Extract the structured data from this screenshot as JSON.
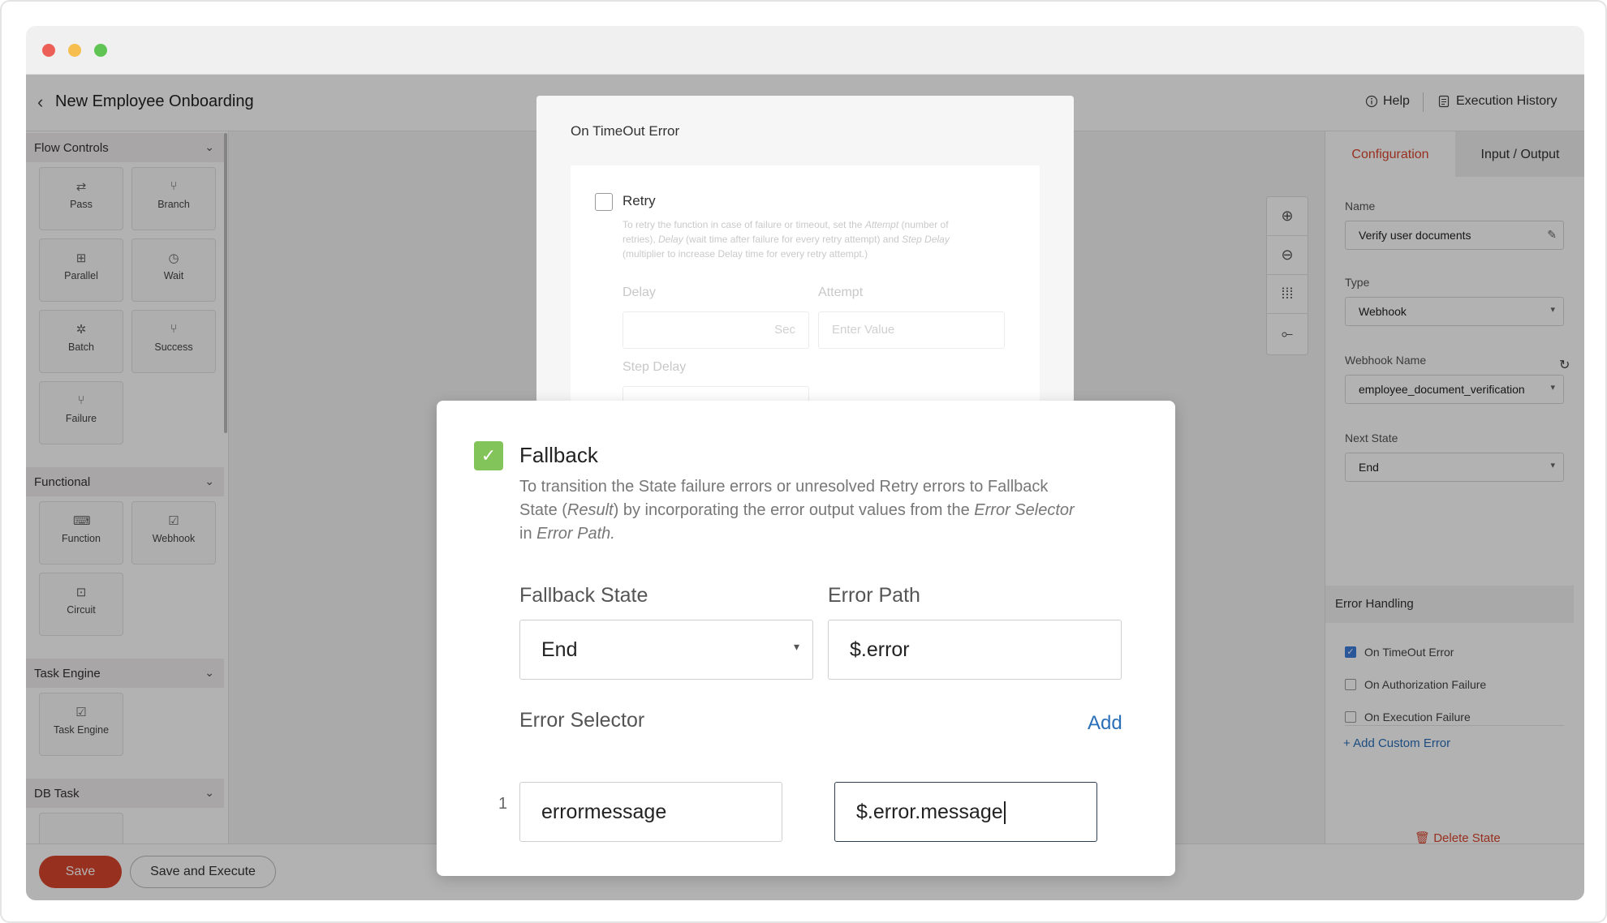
{
  "app": {
    "title": "New Employee Onboarding",
    "help_label": "Help",
    "history_label": "Execution History"
  },
  "sidebar": {
    "sections": [
      {
        "title": "Flow Controls",
        "items": [
          "Pass",
          "Branch",
          "Parallel",
          "Wait",
          "Batch",
          "Success",
          "Failure"
        ]
      },
      {
        "title": "Functional",
        "items": [
          "Function",
          "Webhook",
          "Circuit"
        ]
      },
      {
        "title": "Task Engine",
        "items": [
          "Task Engine"
        ]
      },
      {
        "title": "DB Task",
        "items": []
      }
    ]
  },
  "right_panel": {
    "tabs": [
      "Configuration",
      "Input / Output"
    ],
    "name_label": "Name",
    "name_value": "Verify user documents",
    "type_label": "Type",
    "type_value": "Webhook",
    "webhook_name_label": "Webhook Name",
    "webhook_name_value": "employee_document_verification",
    "next_state_label": "Next State",
    "next_state_value": "End",
    "error_handling_title": "Error Handling",
    "errors": [
      {
        "label": "On TimeOut Error",
        "checked": true
      },
      {
        "label": "On Authorization Failure",
        "checked": false
      },
      {
        "label": "On Execution Failure",
        "checked": false
      }
    ],
    "add_custom_error": "Add Custom Error",
    "delete_state": "Delete State"
  },
  "footer": {
    "save_label": "Save",
    "save_execute_label": "Save and Execute"
  },
  "timeout_modal": {
    "title": "On TimeOut Error",
    "retry_label": "Retry",
    "retry_desc_1": "To retry the function in case of failure or timeout, set the ",
    "retry_desc_attempt": "Attempt",
    "retry_desc_2": " (number of retries), ",
    "retry_desc_delay": "Delay",
    "retry_desc_3": " (wait time after failure for every retry attempt) and ",
    "retry_desc_stepdelay": "Step Delay",
    "retry_desc_4": " (multiplier to increase Delay time for every retry attempt.)",
    "delay_label": "Delay",
    "delay_unit": "Sec",
    "attempt_label": "Attempt",
    "attempt_placeholder": "Enter Value",
    "step_delay_label": "Step Delay"
  },
  "fallback_modal": {
    "title": "Fallback",
    "checked": true,
    "desc_1": "To transition the State failure errors or unresolved Retry errors to Fallback State (",
    "desc_result": "Result",
    "desc_2": ") by incorporating the error output values from the ",
    "desc_selector": "Error Selector",
    "desc_3": " in ",
    "desc_path": "Error Path.",
    "fallback_state_label": "Fallback State",
    "fallback_state_value": "End",
    "error_path_label": "Error Path",
    "error_path_value": "$.error",
    "error_selector_label": "Error Selector",
    "add_label": "Add",
    "selector_rows": [
      {
        "index": "1",
        "key": "errormessage",
        "value": "$.error.message"
      }
    ]
  },
  "colors": {
    "accent": "#d9452d",
    "link": "#2a6fb8",
    "check_green": "#82c35a",
    "check_blue": "#3b7ddd"
  }
}
